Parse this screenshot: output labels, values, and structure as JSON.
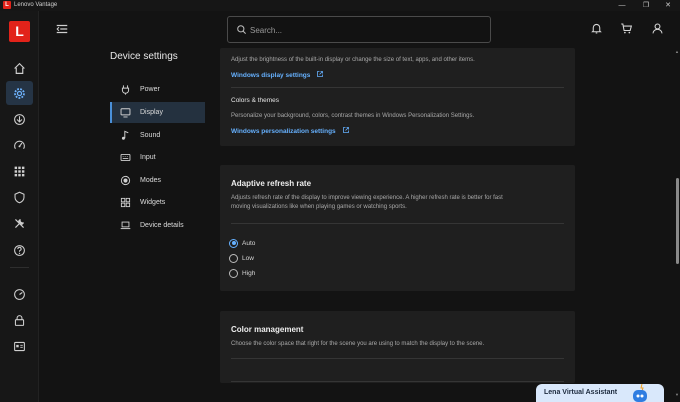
{
  "window": {
    "title": "Lenovo Vantage",
    "logo_letter": "L",
    "minimize": "—",
    "restore": "❐",
    "close": "✕"
  },
  "brand": {
    "letter": "L",
    "color": "#e2231a"
  },
  "rail": {
    "items": [
      {
        "icon": "home-icon"
      },
      {
        "icon": "gear-icon",
        "active": true
      },
      {
        "icon": "download-icon"
      },
      {
        "icon": "speedometer-icon"
      },
      {
        "icon": "apps-grid-icon"
      },
      {
        "icon": "shield-icon"
      },
      {
        "icon": "tools-icon"
      },
      {
        "icon": "help-icon"
      },
      {
        "icon": "gauge-icon"
      },
      {
        "icon": "lock-icon"
      },
      {
        "icon": "id-card-icon"
      }
    ]
  },
  "header": {
    "search_placeholder": "Search...",
    "icons": [
      "bell-icon",
      "cart-icon",
      "user-icon"
    ]
  },
  "nav": {
    "title": "Device settings",
    "items": [
      {
        "label": "Power",
        "icon": "plug-icon"
      },
      {
        "label": "Display",
        "icon": "monitor-icon",
        "active": true
      },
      {
        "label": "Sound",
        "icon": "music-note-icon"
      },
      {
        "label": "Input",
        "icon": "keyboard-icon"
      },
      {
        "label": "Modes",
        "icon": "modes-icon"
      },
      {
        "label": "Widgets",
        "icon": "widgets-icon"
      },
      {
        "label": "Device details",
        "icon": "laptop-icon"
      }
    ]
  },
  "display_card": {
    "brightness_desc": "Adjust the brightness of the built-in display or change the size of text, apps, and other items.",
    "display_link": "Windows display settings",
    "colors_title": "Colors & themes",
    "colors_desc": "Personalize your background, colors, contrast themes in Windows Personalization Settings.",
    "personalization_link": "Windows personalization settings"
  },
  "refresh_card": {
    "title": "Adaptive refresh rate",
    "desc_line1": "Adjusts refresh rate of the display to improve viewing experience. A higher refresh rate is better for fast",
    "desc_line2": "moving visualizations like when playing games or watching sports.",
    "options": [
      {
        "label": "Auto",
        "checked": true
      },
      {
        "label": "Low",
        "checked": false
      },
      {
        "label": "High",
        "checked": false
      }
    ]
  },
  "color_card": {
    "title": "Color management",
    "desc": "Choose the color space that right for the scene you are using to match the display to the scene."
  },
  "assistant": {
    "label": "Lena Virtual Assistant"
  },
  "colors": {
    "accent": "#66b1ff",
    "background": "#131313",
    "card": "#1f1f1f",
    "brand_red": "#e2231a"
  }
}
